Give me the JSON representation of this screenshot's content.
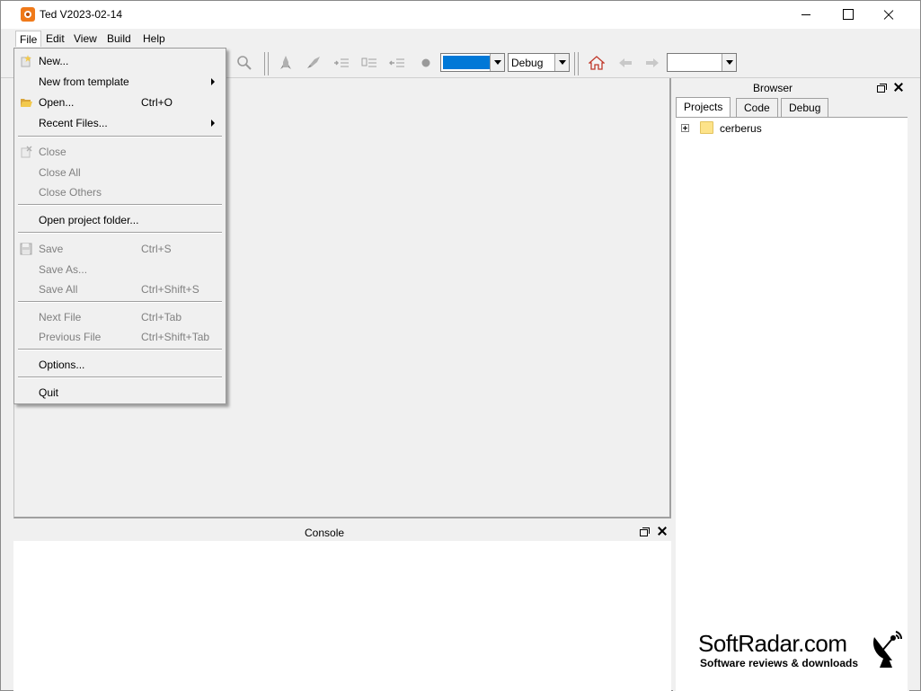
{
  "window": {
    "title": "Ted V2023-02-14"
  },
  "menubar": {
    "items": [
      "File",
      "Edit",
      "View",
      "Build",
      "Help"
    ]
  },
  "toolbar": {
    "color_combo_value": "",
    "build_config": "Debug",
    "target_combo_value": "",
    "icons": [
      "search-icon",
      "rocket-icon",
      "rocket-launch-icon",
      "indent-icon",
      "indent-block-icon",
      "outdent-icon",
      "record-dot-icon",
      "home-icon",
      "back-arrow-icon",
      "forward-arrow-icon"
    ],
    "accent_color": "#0078d7"
  },
  "file_menu": {
    "items": [
      {
        "label": "New...",
        "shortcut": "",
        "enabled": true,
        "submenu": false,
        "icon": "new-file-icon"
      },
      {
        "label": "New from template",
        "shortcut": "",
        "enabled": true,
        "submenu": true
      },
      {
        "label": "Open...",
        "shortcut": "Ctrl+O",
        "enabled": true,
        "submenu": false,
        "icon": "open-folder-icon"
      },
      {
        "label": "Recent Files...",
        "shortcut": "",
        "enabled": true,
        "submenu": true
      },
      {
        "label": "Close",
        "shortcut": "",
        "enabled": false,
        "submenu": false,
        "icon": "close-file-icon"
      },
      {
        "label": "Close All",
        "shortcut": "",
        "enabled": false,
        "submenu": false
      },
      {
        "label": "Close Others",
        "shortcut": "",
        "enabled": false,
        "submenu": false
      },
      {
        "label": "Open project folder...",
        "shortcut": "",
        "enabled": true,
        "submenu": false
      },
      {
        "label": "Save",
        "shortcut": "Ctrl+S",
        "enabled": false,
        "submenu": false,
        "icon": "save-icon"
      },
      {
        "label": "Save As...",
        "shortcut": "",
        "enabled": false,
        "submenu": false
      },
      {
        "label": "Save All",
        "shortcut": "Ctrl+Shift+S",
        "enabled": false,
        "submenu": false
      },
      {
        "label": "Next File",
        "shortcut": "Ctrl+Tab",
        "enabled": false,
        "submenu": false
      },
      {
        "label": "Previous File",
        "shortcut": "Ctrl+Shift+Tab",
        "enabled": false,
        "submenu": false
      },
      {
        "label": "Options...",
        "shortcut": "",
        "enabled": true,
        "submenu": false
      },
      {
        "label": "Quit",
        "shortcut": "",
        "enabled": true,
        "submenu": false
      }
    ]
  },
  "browser": {
    "title": "Browser",
    "tabs": [
      "Projects",
      "Code",
      "Debug"
    ],
    "active_tab": "Projects",
    "tree": [
      {
        "label": "cerberus",
        "icon": "folder-icon",
        "expandable": true
      }
    ]
  },
  "console": {
    "title": "Console"
  },
  "watermark": {
    "title": "SoftRadar.com",
    "subtitle": "Software reviews & downloads"
  }
}
